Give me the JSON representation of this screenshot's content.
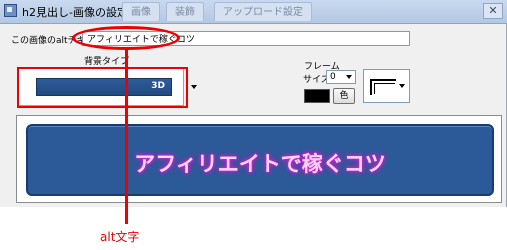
{
  "window": {
    "title": "h2見出し-画像の設定",
    "tabs": [
      "画像",
      "装飾",
      "アップロード設定"
    ],
    "close_glyph": "✕"
  },
  "alt_text": {
    "label": "この画像のaltテキスト",
    "value": "アフィリエイトで稼ぐコツ"
  },
  "background": {
    "label": "背景タイプ",
    "selected": "3D",
    "swatch_color": "#2c5a98"
  },
  "frame": {
    "label": "フレーム",
    "size_label": "サイズ",
    "size_value": "0",
    "color_swatch": "#000000",
    "color_button": "色"
  },
  "preview": {
    "text": "アフィリエイトで稼ぐコツ",
    "bg_color": "#2c5a98",
    "text_glow_color": "#e020d0"
  },
  "annotation": {
    "label": "alt文字",
    "color": "#ee0000"
  }
}
